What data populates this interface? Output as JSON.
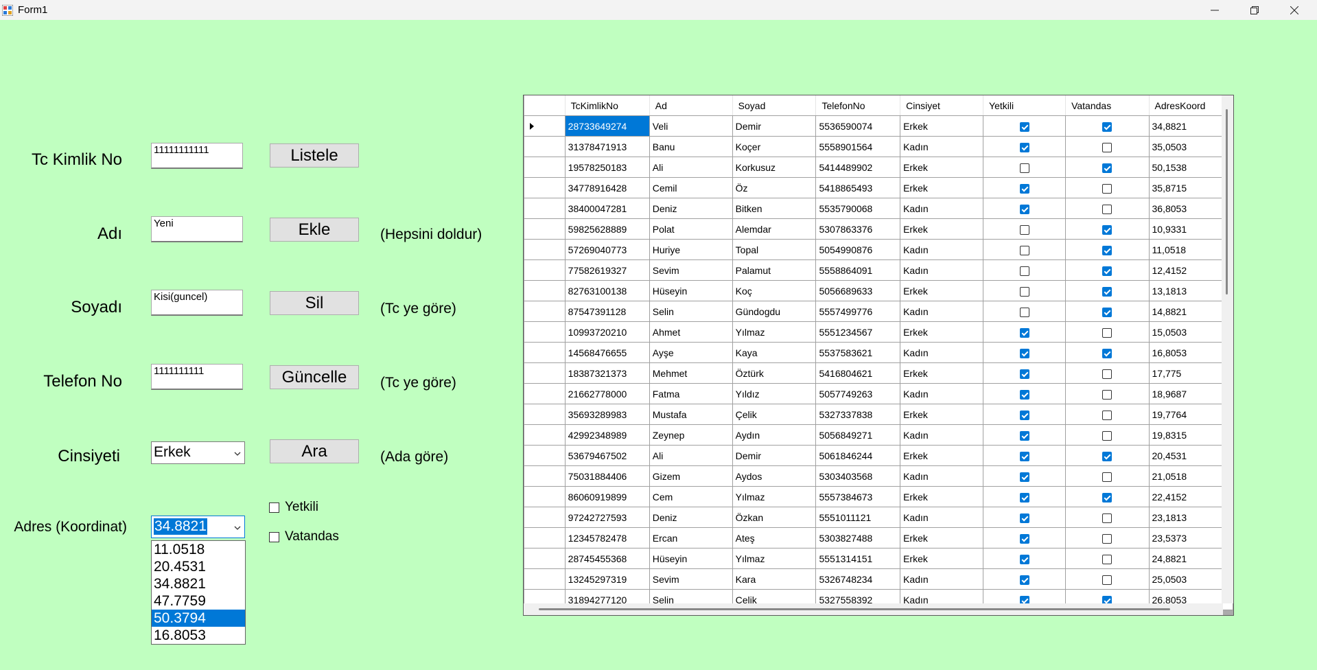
{
  "window": {
    "title": "Form1",
    "icon": "form-app-icon"
  },
  "form": {
    "tc_label": "Tc Kimlik No",
    "ad_label": "Adı",
    "soyad_label": "Soyadı",
    "telefon_label": "Telefon No",
    "cinsiyet_label": "Cinsiyeti",
    "adres_label": "Adres (Koordinat)",
    "tc_value": "11111111111",
    "ad_value": "Yeni",
    "soyad_value": "Kisi(guncel)",
    "telefon_value": "1111111111",
    "cinsiyet_value": "Erkek",
    "adres_value": "34.8821",
    "yetkili_label": "Yetkili",
    "vatandas_label": "Vatandas",
    "yetkili_checked": false,
    "vatandas_checked": false,
    "adres_options": [
      "11.0518",
      "20.4531",
      "34.8821",
      "47.7759",
      "50.3794",
      "16.8053"
    ],
    "adres_highlighted": "50.3794"
  },
  "buttons": {
    "listele": "Listele",
    "ekle": "Ekle",
    "sil": "Sil",
    "guncelle": "Güncelle",
    "ara": "Ara"
  },
  "hints": {
    "ekle": "(Hepsini doldur)",
    "sil": "(Tc ye göre)",
    "guncelle": "(Tc ye göre)",
    "ara": "(Ada göre)"
  },
  "grid": {
    "columns": [
      "TcKimlikNo",
      "Ad",
      "Soyad",
      "TelefonNo",
      "Cinsiyet",
      "Yetkili",
      "Vatandas",
      "AdresKoord"
    ],
    "rows": [
      [
        "28733649274",
        "Veli",
        "Demir",
        "5536590074",
        "Erkek",
        true,
        true,
        "34,8821"
      ],
      [
        "31378471913",
        "Banu",
        "Koçer",
        "5558901564",
        "Kadın",
        true,
        false,
        "35,0503"
      ],
      [
        "19578250183",
        "Ali",
        "Korkusuz",
        "5414489902",
        "Erkek",
        false,
        true,
        "50,1538"
      ],
      [
        "34778916428",
        "Cemil",
        "Öz",
        "5418865493",
        "Erkek",
        true,
        false,
        "35,8715"
      ],
      [
        "38400047281",
        "Deniz",
        "Bitken",
        "5535790068",
        "Kadın",
        true,
        false,
        "36,8053"
      ],
      [
        "59825628889",
        "Polat",
        "Alemdar",
        "5307863376",
        "Erkek",
        false,
        true,
        "10,9331"
      ],
      [
        "57269040773",
        "Huriye",
        "Topal",
        "5054990876",
        "Kadın",
        false,
        true,
        "11,0518"
      ],
      [
        "77582619327",
        "Sevim",
        "Palamut",
        "5558864091",
        "Kadın",
        false,
        true,
        "12,4152"
      ],
      [
        "82763100138",
        "Hüseyin",
        "Koç",
        "5056689633",
        "Erkek",
        false,
        true,
        "13,1813"
      ],
      [
        "87547391128",
        "Selin",
        "Gündogdu",
        "5557499776",
        "Kadın",
        false,
        true,
        "14,8821"
      ],
      [
        "10993720210",
        "Ahmet",
        "Yılmaz",
        "5551234567",
        "Erkek",
        true,
        false,
        "15,0503"
      ],
      [
        "14568476655",
        "Ayşe",
        "Kaya",
        "5537583621",
        "Kadın",
        true,
        true,
        "16,8053"
      ],
      [
        "18387321373",
        "Mehmet",
        "Öztürk",
        "5416804621",
        "Erkek",
        true,
        false,
        "17,775"
      ],
      [
        "21662778000",
        "Fatma",
        "Yıldız",
        "5057749263",
        "Kadın",
        true,
        false,
        "18,9687"
      ],
      [
        "35693289983",
        "Mustafa",
        "Çelik",
        "5327337838",
        "Erkek",
        true,
        false,
        "19,7764"
      ],
      [
        "42992348989",
        "Zeynep",
        "Aydın",
        "5056849271",
        "Kadın",
        true,
        false,
        "19,8315"
      ],
      [
        "53679467502",
        "Ali",
        "Demir",
        "5061846244",
        "Erkek",
        true,
        true,
        "20,4531"
      ],
      [
        "75031884406",
        "Gizem",
        "Aydos",
        "5303403568",
        "Kadın",
        true,
        false,
        "21,0518"
      ],
      [
        "86060919899",
        "Cem",
        "Yılmaz",
        "5557384673",
        "Erkek",
        true,
        true,
        "22,4152"
      ],
      [
        "97242727593",
        "Deniz",
        "Özkan",
        "5551011121",
        "Kadın",
        true,
        false,
        "23,1813"
      ],
      [
        "12345782478",
        "Ercan",
        "Ateş",
        "5303827488",
        "Erkek",
        true,
        false,
        "23,5373"
      ],
      [
        "28745455368",
        "Hüseyin",
        "Yılmaz",
        "5551314151",
        "Erkek",
        true,
        false,
        "24,8821"
      ],
      [
        "13245297319",
        "Sevim",
        "Kara",
        "5326748234",
        "Kadın",
        true,
        false,
        "25,0503"
      ],
      [
        "31894277120",
        "Selin",
        "Celik",
        "5327558392",
        "Kadın",
        true,
        true,
        "26,8053"
      ]
    ]
  }
}
